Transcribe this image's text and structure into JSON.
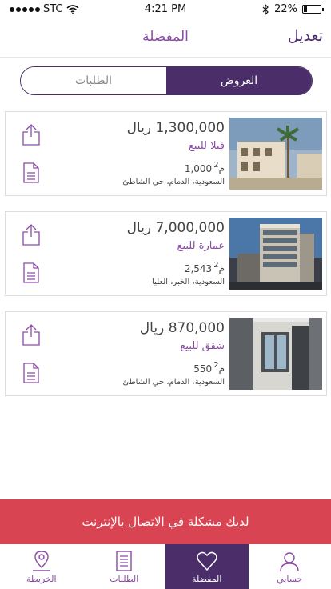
{
  "status": {
    "carrier": "STC",
    "time": "4:21 PM",
    "battery": "22%",
    "battery_level": 0.22
  },
  "nav": {
    "edit_label": "تعديل",
    "title": "المفضلة"
  },
  "segments": {
    "offers": "العروض",
    "requests": "الطلبات"
  },
  "listings": [
    {
      "price": "1,300,000 ريال",
      "type": "فيلا للبيع",
      "area": "1,000",
      "unit": "م",
      "unit_sup": "2",
      "location": "السعودية، الدمام، حي الشاطئ",
      "photo": "villa"
    },
    {
      "price": "7,000,000 ريال",
      "type": "عمارة للبيع",
      "area": "2,543",
      "unit": "م",
      "unit_sup": "2",
      "location": "السعودية، الخبر، العليا",
      "photo": "building"
    },
    {
      "price": "870,000 ريال",
      "type": "شقق للبيع",
      "area": "550",
      "unit": "م",
      "unit_sup": "2",
      "location": "السعودية، الدمام، حي الشاطئ",
      "photo": "apartment"
    }
  ],
  "error_banner": "لديك مشكلة في الاتصال بالإنترنت",
  "tabs": {
    "account": "حسابي",
    "favorites": "المفضلة",
    "requests": "الطلبات",
    "map": "الخريطة"
  },
  "colors": {
    "accent": "#4b2d69",
    "accent_light": "#8a4aa6",
    "error": "#d94452"
  },
  "icons": [
    "signal-icon",
    "wifi-icon",
    "bluetooth-icon",
    "battery-icon",
    "share-icon",
    "document-icon",
    "user-icon",
    "heart-icon",
    "map-pin-icon"
  ]
}
